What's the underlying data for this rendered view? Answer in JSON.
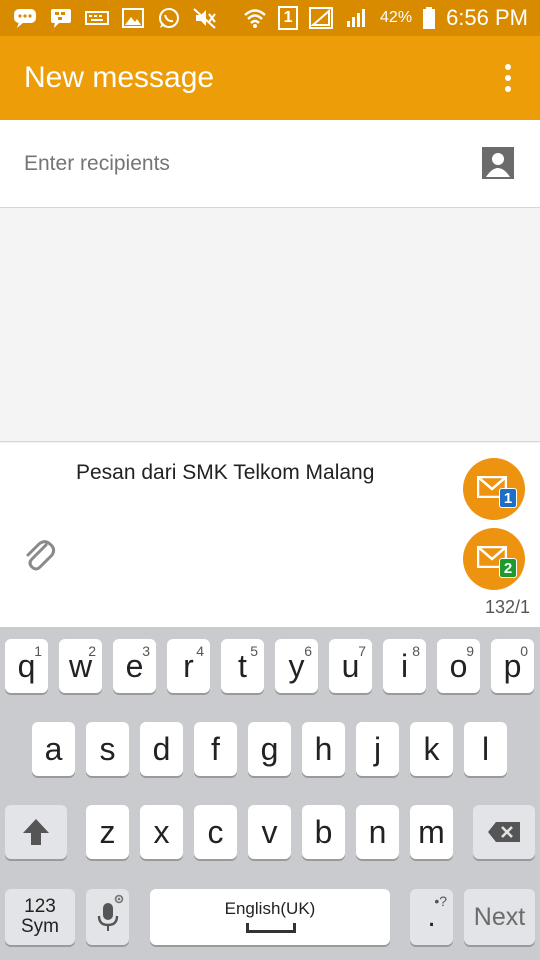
{
  "status_bar": {
    "icons": [
      "chat-bubble-icon",
      "bbm-icon",
      "keyboard-icon",
      "gallery-icon",
      "whatsapp-icon",
      "mute-icon",
      "wifi-icon",
      "sim1-badge",
      "signal-1-icon",
      "signal-2-icon",
      "battery-icon"
    ],
    "sim_badge": "1",
    "battery": "42%",
    "time": "6:56 PM"
  },
  "app_bar": {
    "title": "New message",
    "menu_icon": "more-vertical-icon",
    "color": "#ec9d07"
  },
  "recipients": {
    "placeholder": "Enter recipients",
    "value": "",
    "contact_icon": "contact-picker-icon"
  },
  "compose": {
    "text": "Pesan dari SMK Telkom Malang",
    "attach_icon": "paperclip-icon",
    "send_buttons": [
      {
        "sim": "1",
        "color": "#1c6fc4"
      },
      {
        "sim": "2",
        "color": "#1f9a2f"
      }
    ],
    "counter": "132/1",
    "accent": "#ee9310"
  },
  "keyboard": {
    "row1": [
      {
        "key": "q",
        "num": "1"
      },
      {
        "key": "w",
        "num": "2"
      },
      {
        "key": "e",
        "num": "3"
      },
      {
        "key": "r",
        "num": "4"
      },
      {
        "key": "t",
        "num": "5"
      },
      {
        "key": "y",
        "num": "6"
      },
      {
        "key": "u",
        "num": "7"
      },
      {
        "key": "i",
        "num": "8"
      },
      {
        "key": "o",
        "num": "9"
      },
      {
        "key": "p",
        "num": "0"
      }
    ],
    "row2": [
      "a",
      "s",
      "d",
      "f",
      "g",
      "h",
      "j",
      "k",
      "l"
    ],
    "row3": [
      "z",
      "x",
      "c",
      "v",
      "b",
      "n",
      "m"
    ],
    "sym_label_1": "123",
    "sym_label_2": "Sym",
    "space_label": "English(UK)",
    "period_label": ".",
    "period_hint": "•?",
    "next_label": "Next"
  }
}
